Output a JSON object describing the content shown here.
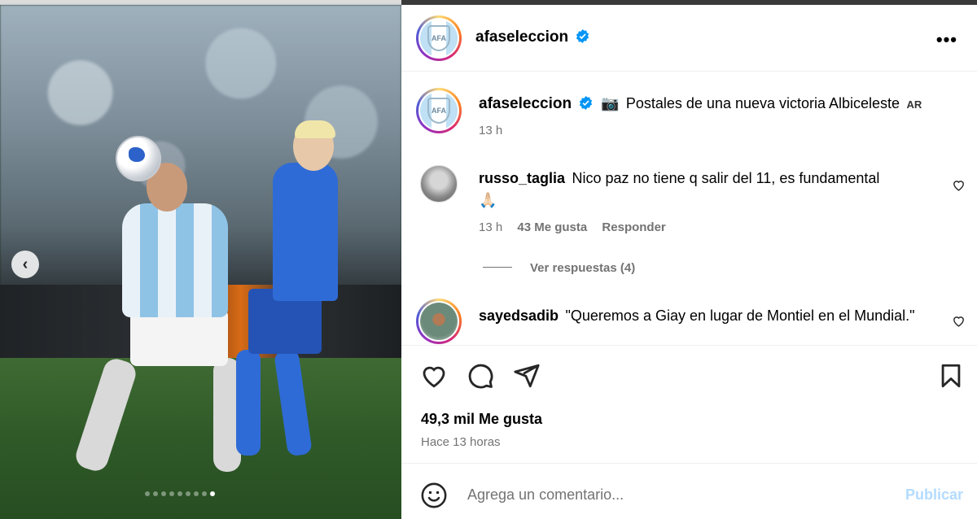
{
  "post": {
    "author": "afaseleccion",
    "more_label": "•••",
    "caption_emoji": "📷",
    "caption": "Postales de una nueva victoria Albiceleste",
    "caption_flag": "AR",
    "caption_time": "13 h",
    "avatar_badge_text": "AFA"
  },
  "media": {
    "carousel_dots": 9,
    "active_dot": 9,
    "prev_icon": "‹"
  },
  "comments": [
    {
      "user": "russo_taglia",
      "text": "Nico paz no tiene q salir del 11, es fundamental",
      "emoji": "🙏🏻",
      "time": "13 h",
      "likes": "43 Me gusta",
      "reply_label": "Responder",
      "view_replies": "Ver respuestas (4)"
    },
    {
      "user": "sayedsadib",
      "text": "\"Queremos a Giay en lugar de Montiel en el Mundial.\""
    }
  ],
  "stats": {
    "likes": "49,3 mil Me gusta",
    "posted": "Hace 13 horas"
  },
  "composer": {
    "placeholder": "Agrega un comentario...",
    "emoji_icon": "smiley-icon",
    "post_label": "Publicar"
  },
  "colors": {
    "verified": "#0095f6",
    "publish_disabled": "#b3dbff",
    "muted_text": "#737373"
  }
}
